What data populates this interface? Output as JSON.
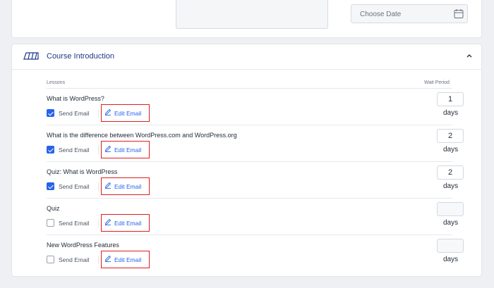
{
  "top": {
    "date_placeholder": "Choose Date"
  },
  "course": {
    "title": "Course Introduction",
    "col_lessons": "Lessons",
    "col_wait": "Wait Period",
    "lessons": [
      {
        "title": "What is WordPress?",
        "send_email": true,
        "send_label": "Send Email",
        "edit_label": "Edit Email",
        "wait": "1",
        "unit": "days"
      },
      {
        "title": "What is the difference between WordPress.com and WordPress.org",
        "send_email": true,
        "send_label": "Send Email",
        "edit_label": "Edit Email",
        "wait": "2",
        "unit": "days"
      },
      {
        "title": "Quiz: What is WordPress",
        "send_email": true,
        "send_label": "Send Email",
        "edit_label": "Edit Email",
        "wait": "2",
        "unit": "days"
      },
      {
        "title": "Quiz",
        "send_email": false,
        "send_label": "Send Email",
        "edit_label": "Edit Email",
        "wait": "",
        "unit": "days"
      },
      {
        "title": "New WordPress Features",
        "send_email": false,
        "send_label": "Send Email",
        "edit_label": "Edit Email",
        "wait": "",
        "unit": "days"
      }
    ]
  },
  "colors": {
    "accent": "#2563eb",
    "highlight_border": "#e11d1d",
    "title": "#1e3a8a"
  }
}
